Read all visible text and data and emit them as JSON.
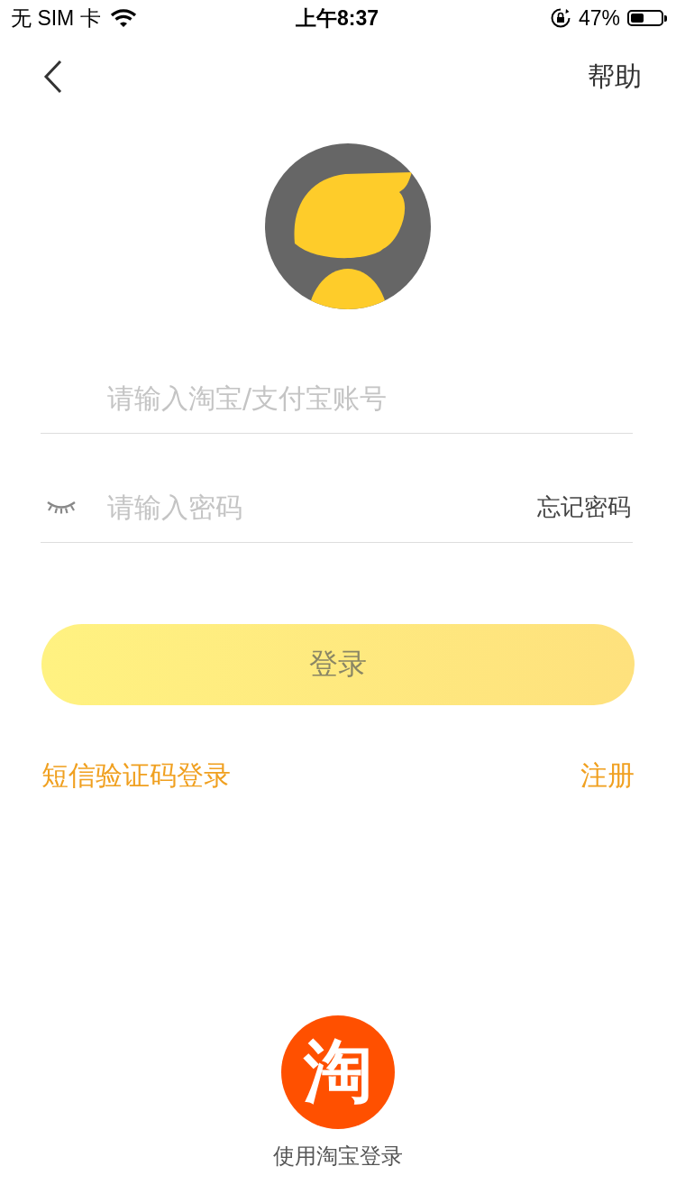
{
  "status_bar": {
    "carrier": "无 SIM 卡",
    "time": "上午8:37",
    "battery_text": "47%"
  },
  "nav": {
    "help": "帮助"
  },
  "account_field": {
    "placeholder": "请输入淘宝/支付宝账号"
  },
  "password_field": {
    "placeholder": "请输入密码",
    "forgot": "忘记密码"
  },
  "login_button": {
    "label": "登录",
    "disabled": true
  },
  "links": {
    "sms_login": "短信验证码登录",
    "register": "注册"
  },
  "taobao_login": {
    "logo_text": "淘",
    "label": "使用淘宝登录"
  }
}
